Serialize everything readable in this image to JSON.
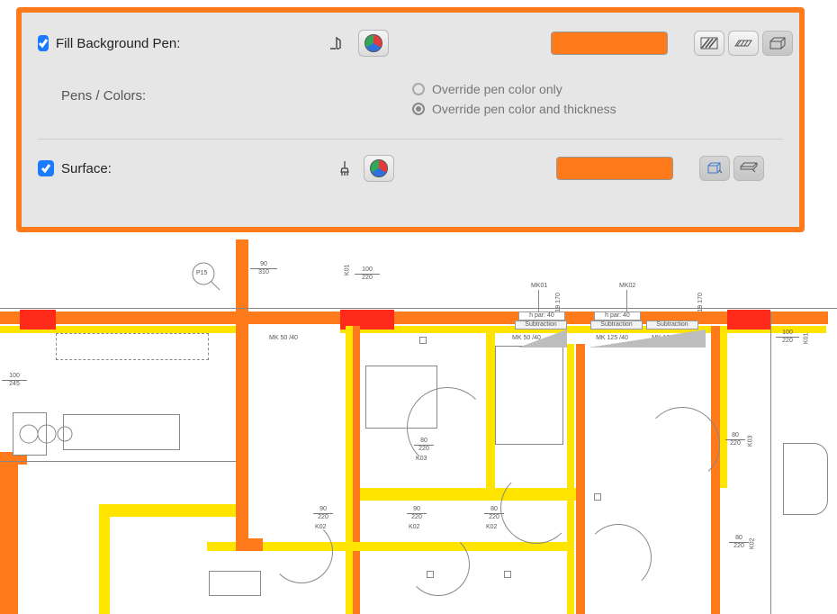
{
  "panel": {
    "fill_bg_pen": {
      "checked": true,
      "label": "Fill Background Pen:",
      "color": "#ff7a1a"
    },
    "pens_colors": {
      "label": "Pens / Colors:",
      "radios": {
        "color_only": "Override pen color only",
        "color_thickness": "Override pen color and thickness",
        "selected": "color_thickness"
      }
    },
    "surface": {
      "checked": true,
      "label": "Surface:",
      "color": "#ff7a1a"
    }
  },
  "floorplan": {
    "callouts": [
      "P15"
    ],
    "openings": [
      {
        "w": "90",
        "h": "310"
      },
      {
        "w": "100",
        "h": "245"
      }
    ],
    "doors": [
      {
        "id": "K01",
        "w": "100",
        "h": "220"
      },
      {
        "id": "K02",
        "w": "90",
        "h": "220"
      },
      {
        "id": "K02",
        "w": "90",
        "h": "220"
      },
      {
        "id": "K02",
        "w": "80",
        "h": "220"
      },
      {
        "id": "K02",
        "w": "80",
        "h": "220"
      },
      {
        "id": "K03",
        "w": "80",
        "h": "220"
      },
      {
        "id": "K03",
        "w": "80",
        "h": "220"
      },
      {
        "id": "K01",
        "w": "100",
        "h": "220"
      }
    ],
    "window_markers": [
      "MK01",
      "MK02"
    ],
    "window_labels": [
      "MK 50 /40",
      "MK 50 /40",
      "MK 125 /40",
      "MK 185 /40"
    ],
    "header_note": "h par: 40",
    "sub_label": "Subtraction",
    "gap_dims": [
      {
        "a": "19",
        "b": "170"
      },
      {
        "a": "19",
        "b": "170"
      }
    ]
  }
}
